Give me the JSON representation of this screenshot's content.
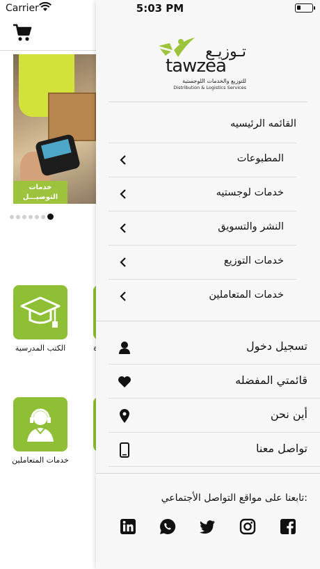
{
  "status_bar": {
    "carrier": "Carrier",
    "time": "5:03 PM"
  },
  "main": {
    "banner_caption_line1": "خدمات",
    "banner_caption_line2": "التوصيـــل",
    "carousel_pages": 7,
    "carousel_active_index": 6,
    "tiles": [
      {
        "label": "الكتب المدرسية",
        "icon": "graduation-cap-icon"
      },
      {
        "label": "خدمات المتعاملين",
        "icon": "customer-support-icon"
      }
    ],
    "partial_tile_label": "ة"
  },
  "drawer": {
    "logo": {
      "arabic": "تـوزيـع",
      "english": "tawzea",
      "sub_ar": "للتوزيع والخدمات اللوجستية",
      "sub_en": "Distribution & Logistics Services"
    },
    "home_label": "القائمه الرئيسيه",
    "menu_items": [
      {
        "label": "المطبوعات"
      },
      {
        "label": "خدمات لوجستيه"
      },
      {
        "label": "النشر والتسويق"
      },
      {
        "label": "خدمات التوزيع"
      },
      {
        "label": "خدمات المتعاملين"
      }
    ],
    "actions": [
      {
        "label": "تسجيل دخول",
        "icon": "user-icon"
      },
      {
        "label": "قائمتي المفضله",
        "icon": "heart-icon"
      },
      {
        "label": "أين نحن",
        "icon": "location-pin-icon"
      },
      {
        "label": "تواصل معنا",
        "icon": "mobile-phone-icon"
      }
    ],
    "follow_label": "تابعنا على مواقع التواصل الأجتماعي:",
    "social": [
      "linkedin-icon",
      "whatsapp-icon",
      "twitter-icon",
      "instagram-icon",
      "facebook-icon"
    ]
  },
  "colors": {
    "brand_green": "#8fbf34",
    "drawer_bg": "#f7f7f7"
  }
}
